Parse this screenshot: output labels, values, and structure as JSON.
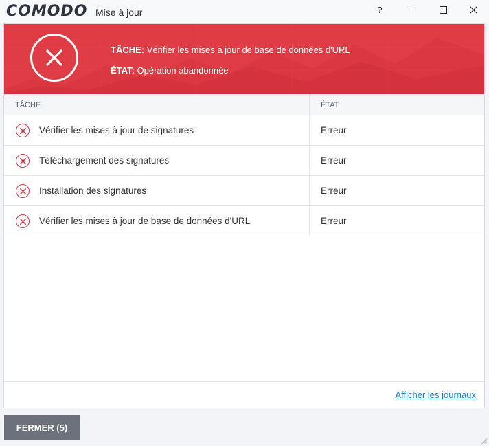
{
  "window": {
    "brand": "COMODO",
    "title": "Mise à jour",
    "help_label": "?",
    "minimize_icon": "minimize-icon",
    "maximize_icon": "maximize-icon",
    "close_icon": "close-icon"
  },
  "banner": {
    "task_label": "TÂCHE:",
    "task_value": "Vérifier les mises à jour de base de données d'URL",
    "state_label": "ÉTAT:",
    "state_value": "Opération abandonnée",
    "icon": "error-circle-icon",
    "color": "#e03c46"
  },
  "table": {
    "headers": {
      "task": "TÂCHE",
      "state": "ÉTAT"
    },
    "rows": [
      {
        "task": "Vérifier les mises à jour de signatures",
        "state": "Erreur",
        "icon": "error-icon"
      },
      {
        "task": "Téléchargement des signatures",
        "state": "Erreur",
        "icon": "error-icon"
      },
      {
        "task": "Installation des signatures",
        "state": "Erreur",
        "icon": "error-icon"
      },
      {
        "task": "Vérifier les mises à jour de base de données d'URL",
        "state": "Erreur",
        "icon": "error-icon"
      }
    ]
  },
  "footer": {
    "logs_link": "Afficher les journaux",
    "close_button": "FERMER (5)"
  },
  "colors": {
    "accent_red": "#e03c46",
    "link_blue": "#2a7fc0",
    "button_gray": "#6c717b"
  }
}
